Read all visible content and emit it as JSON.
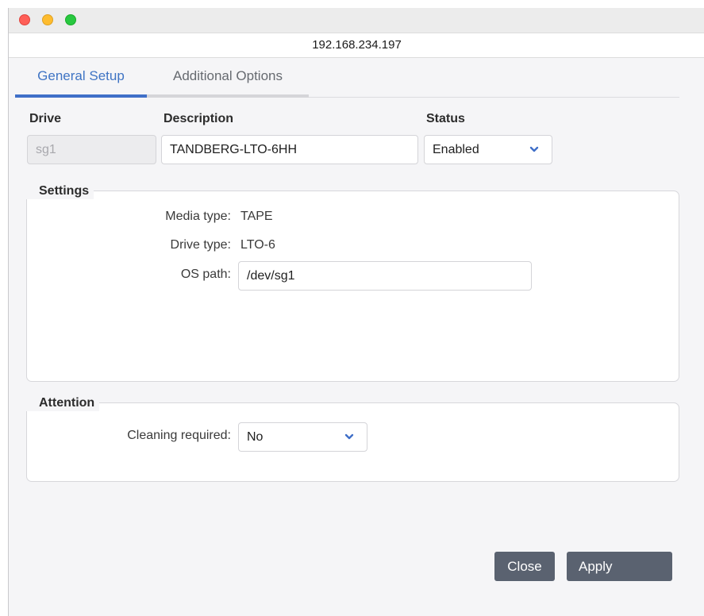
{
  "window": {
    "address": "192.168.234.197"
  },
  "tabs": [
    {
      "label": "General Setup",
      "active": true
    },
    {
      "label": "Additional Options",
      "active": false
    }
  ],
  "drive": {
    "drive_label": "Drive",
    "drive_value": "sg1",
    "description_label": "Description",
    "description_value": "TANDBERG-LTO-6HH",
    "status_label": "Status",
    "status_value": "Enabled"
  },
  "settings": {
    "title": "Settings",
    "media_type_label": "Media type:",
    "media_type_value": "TAPE",
    "drive_type_label": "Drive type:",
    "drive_type_value": "LTO-6",
    "os_path_label": "OS path:",
    "os_path_value": "/dev/sg1"
  },
  "attention": {
    "title": "Attention",
    "cleaning_label": "Cleaning required:",
    "cleaning_value": "No"
  },
  "buttons": {
    "close": "Close",
    "apply": "Apply"
  },
  "colors": {
    "accent": "#3f74c4",
    "button": "#5a6270",
    "chevron": "#3f6fc8"
  },
  "icons": {
    "close_dot": "traffic-light-red",
    "minimize_dot": "traffic-light-yellow",
    "zoom_dot": "traffic-light-green",
    "select_chevron": "chevron-down-icon"
  }
}
